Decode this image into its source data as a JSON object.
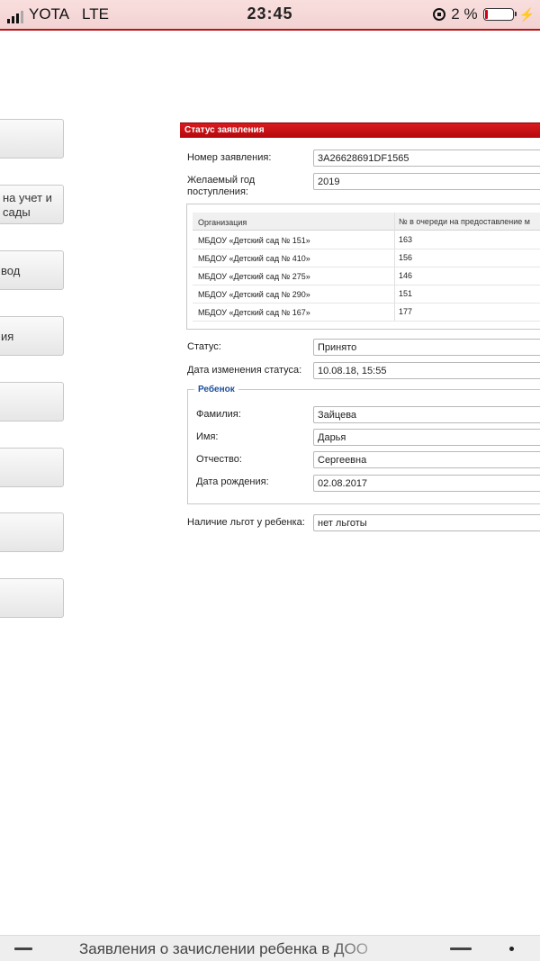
{
  "status_bar": {
    "carrier": "YOTA",
    "network": "LTE",
    "time": "23:45",
    "battery_percent": "2 %",
    "battery_level": 0.02
  },
  "left_buttons": [
    {
      "label": ""
    },
    {
      "label": "на учет и сады"
    },
    {
      "label": "вод"
    },
    {
      "label": "ия"
    },
    {
      "label": ""
    },
    {
      "label": ""
    },
    {
      "label": ""
    },
    {
      "label": ""
    }
  ],
  "panel": {
    "title": "Статус заявления",
    "application_number_label": "Номер заявления:",
    "application_number": "3A26628691DF1565",
    "year_label": "Желаемый год поступления:",
    "year": "2019",
    "table": {
      "headers": [
        "Организация",
        "№ в очереди на предоставление м"
      ],
      "rows": [
        [
          "МБДОУ «Детский сад № 151»",
          "163"
        ],
        [
          "МБДОУ «Детский сад № 410»",
          "156"
        ],
        [
          "МБДОУ «Детский сад № 275»",
          "146"
        ],
        [
          "МБДОУ «Детский сад № 290»",
          "151"
        ],
        [
          "МБДОУ «Детский сад № 167»",
          "177"
        ]
      ]
    },
    "status_label": "Статус:",
    "status": "Принято",
    "status_date_label": "Дата изменения статуса:",
    "status_date": "10.08.18, 15:55",
    "child": {
      "legend": "Ребенок",
      "surname_label": "Фамилия:",
      "surname": "Зайцева",
      "name_label": "Имя:",
      "name": "Дарья",
      "patronymic_label": "Отчество:",
      "patronymic": "Сергеевна",
      "birthdate_label": "Дата рождения:",
      "birthdate": "02.08.2017"
    },
    "benefits_label": "Наличие льгот у ребенка:",
    "benefits": "нет льготы"
  },
  "bottom_bar": {
    "title": "Заявления о зачислении ребенка в ДОО"
  },
  "colors": {
    "header_red": "#c4080d",
    "legend_blue": "#1e4f9c"
  }
}
